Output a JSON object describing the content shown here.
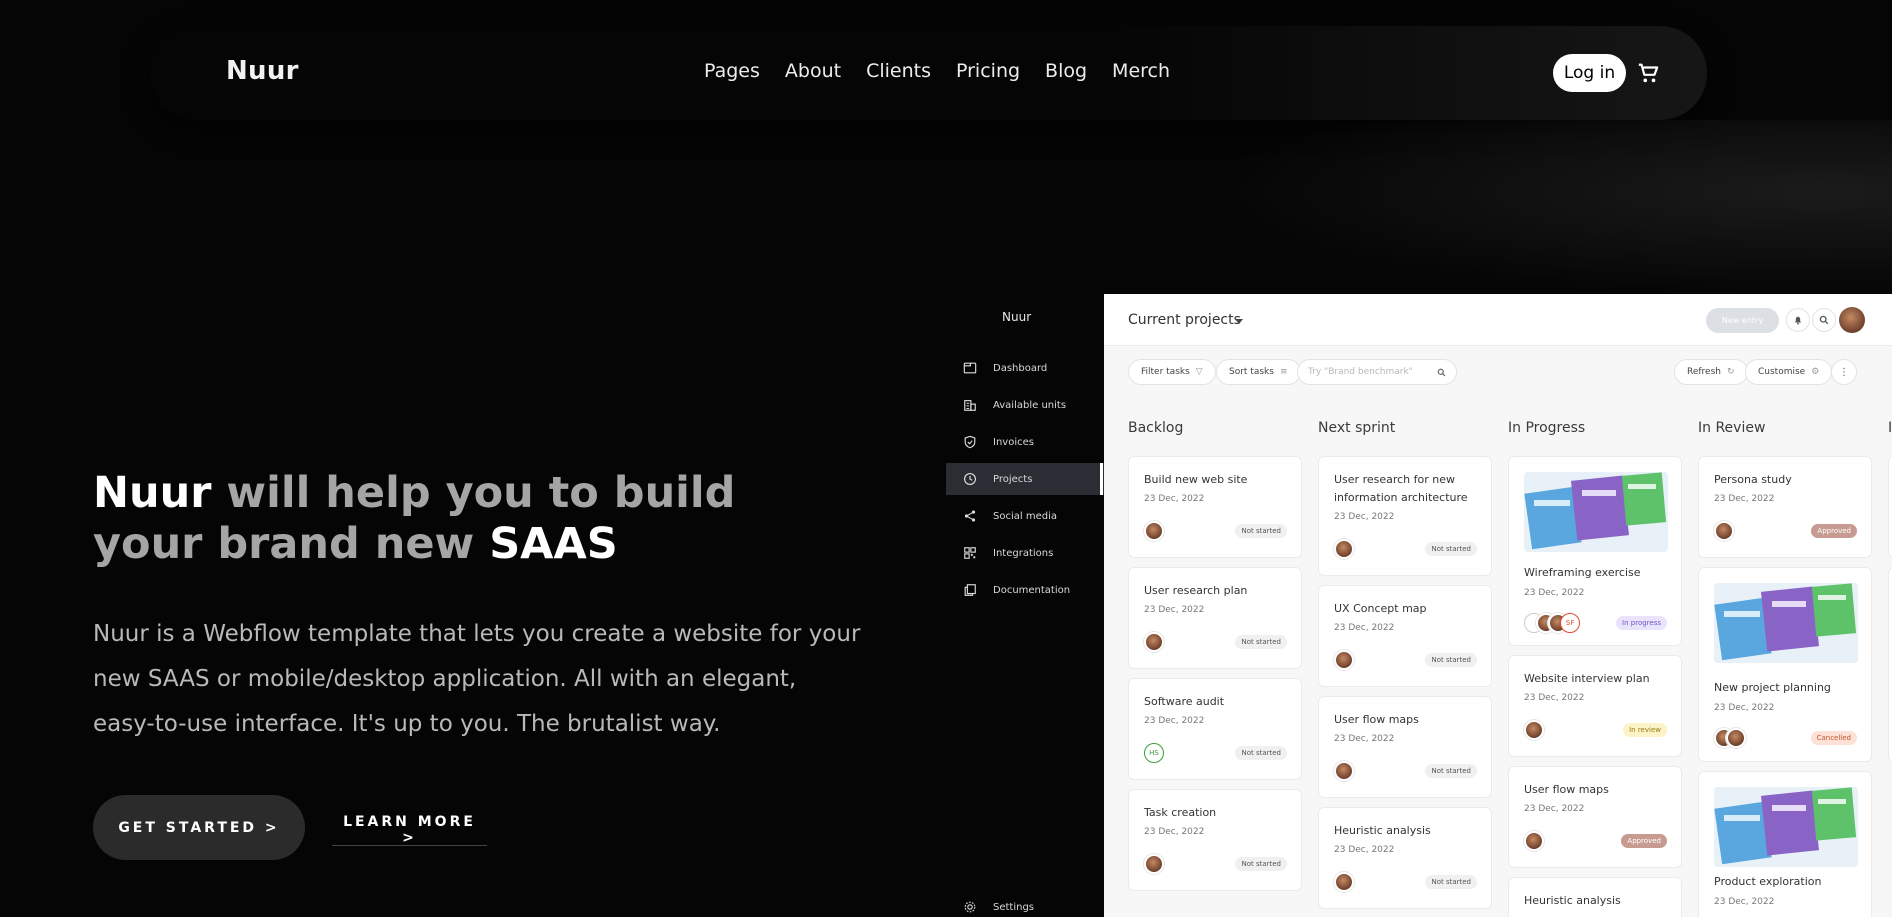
{
  "nav": {
    "brand": "Nuur",
    "menu": [
      "Pages",
      "About",
      "Clients",
      "Pricing",
      "Blog",
      "Merch"
    ],
    "login": "Log in"
  },
  "hero": {
    "title_highlight_1": "Nuur",
    "title_middle": " will help you to build your brand new ",
    "title_highlight_2": "SAAS",
    "description": "Nuur is a Webflow template that lets you create a website for your new SAAS or mobile/desktop application. All with an elegant, easy-to-use interface. It's up to you. The brutalist way.",
    "cta_primary": "GET STARTED >",
    "cta_secondary": "LEARN MORE >"
  },
  "app": {
    "sidebar": {
      "brand": "Nuur",
      "items": [
        "Dashboard",
        "Available units",
        "Invoices",
        "Projects",
        "Social media",
        "Integrations",
        "Documentation"
      ],
      "active": "Projects",
      "bottom": "Settings"
    },
    "header": {
      "title": "Current projects",
      "new_entry": "New entry"
    },
    "toolbar": {
      "filter": "Filter tasks",
      "sort": "Sort tasks",
      "search_placeholder": "Try \"Brand benchmark\"",
      "refresh": "Refresh",
      "customise": "Customise"
    },
    "columns": [
      {
        "title": "Backlog",
        "cards": [
          {
            "title": "Build new web site",
            "date": "23 Dec, 2022",
            "status": "Not started"
          },
          {
            "title": "User research plan",
            "date": "23 Dec, 2022",
            "status": "Not started"
          },
          {
            "title": "Software audit",
            "date": "23 Dec, 2022",
            "status": "Not started",
            "initials": "HS"
          },
          {
            "title": "Task creation",
            "date": "23 Dec, 2022",
            "status": "Not started"
          }
        ]
      },
      {
        "title": "Next sprint",
        "cards": [
          {
            "title": "User research for new information architecture",
            "date": "23 Dec, 2022",
            "status": "Not started"
          },
          {
            "title": "UX Concept map",
            "date": "23 Dec, 2022",
            "status": "Not started"
          },
          {
            "title": "User flow maps",
            "date": "23 Dec, 2022",
            "status": "Not started"
          },
          {
            "title": "Heuristic analysis",
            "date": "23 Dec, 2022",
            "status": "Not started"
          }
        ]
      },
      {
        "title": "In Progress",
        "cards": [
          {
            "title": "Wireframing exercise",
            "date": "23 Dec, 2022",
            "status": "In progress",
            "initials": "SF"
          },
          {
            "title": "Website interview plan",
            "date": "23 Dec, 2022",
            "status": "In review"
          },
          {
            "title": "User flow maps",
            "date": "23 Dec, 2022",
            "status": "Approved"
          },
          {
            "title": "Heuristic analysis"
          }
        ]
      },
      {
        "title": "In Review",
        "cards": [
          {
            "title": "Persona study",
            "date": "23 Dec, 2022",
            "status": "Approved"
          },
          {
            "title": "New project planning",
            "date": "23 Dec, 2022",
            "status": "Cancelled"
          },
          {
            "title": "Product exploration",
            "date": "23 Dec, 2022"
          }
        ]
      }
    ]
  },
  "colors": {
    "background": "#050505",
    "accent": "#ffffff",
    "button_dark": "#2b2b2b",
    "board_bg": "#f7f7f8"
  }
}
